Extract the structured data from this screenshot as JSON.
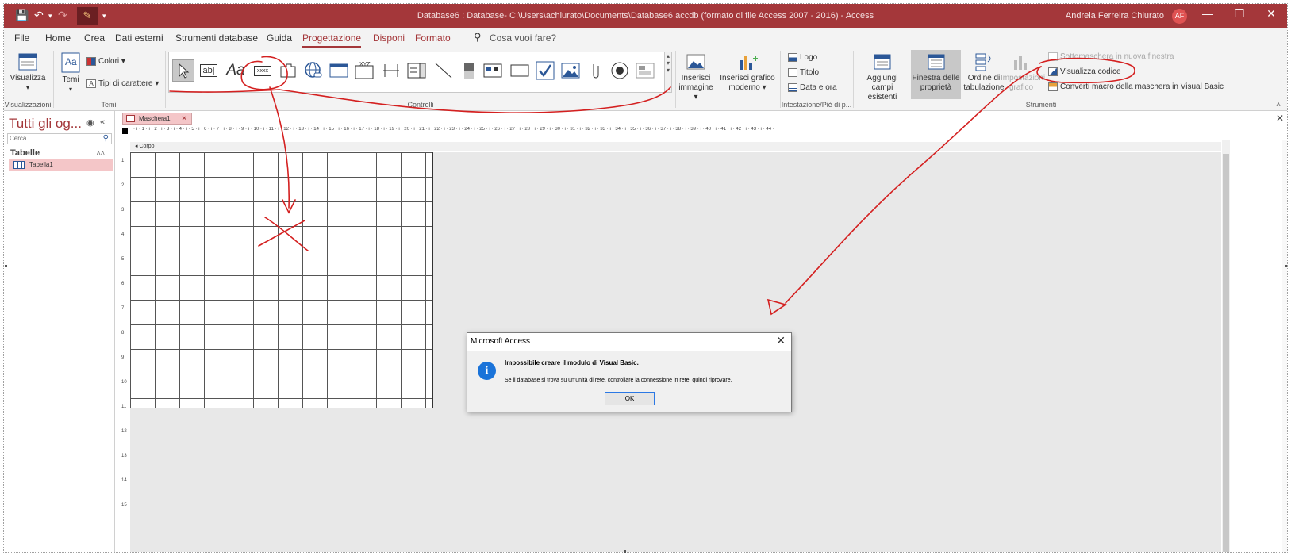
{
  "titlebar": {
    "title": "Database6 : Database- C:\\Users\\achiurato\\Documents\\Database6.accdb (formato di file Access 2007 - 2016)  -  Access",
    "user_name": "Andreia Ferreira Chiurato",
    "user_initials": "AF",
    "save_icon": "save-icon",
    "undo_icon": "undo-icon",
    "redo_icon": "redo-icon"
  },
  "tabs": {
    "file": "File",
    "home": "Home",
    "create": "Crea",
    "external": "Dati esterni",
    "dbtools": "Strumenti database",
    "help": "Guida",
    "design": "Progettazione",
    "arrange": "Disponi",
    "format": "Formato",
    "tell_me": "Cosa vuoi fare?"
  },
  "ribbon": {
    "views": {
      "button": "Visualizza",
      "group": "Visualizzazioni"
    },
    "themes": {
      "button": "Temi",
      "colors": "Colori",
      "fonts": "Tipi di carattere",
      "group": "Temi"
    },
    "controls": {
      "group": "Controlli",
      "items": [
        "select-icon",
        "textbox-icon",
        "label-icon",
        "button-icon",
        "tab-control-icon",
        "hyperlink-icon",
        "web-browser-icon",
        "navigation-control-icon",
        "option-group-icon",
        "page-break-icon",
        "combo-box-icon",
        "line-icon",
        "toggle-button-icon",
        "list-box-icon",
        "rectangle-icon",
        "checkbox-icon",
        "image-icon",
        "attachment-icon",
        "option-button-icon",
        "subform-icon"
      ]
    },
    "insert_image": "Inserisci immagine",
    "insert_chart": "Inserisci grafico moderno",
    "header_footer": {
      "logo": "Logo",
      "title": "Titolo",
      "datetime": "Data e ora",
      "group": "Intestazione/Piè di p..."
    },
    "tools": {
      "group": "Strumenti",
      "add_fields": "Aggiungi campi esistenti",
      "property_sheet": "Finestra delle proprietà",
      "tab_order": "Ordine di tabulazione",
      "chart_settings": "Impostazioni grafico",
      "subform_new_window": "Sottomaschera in nuova finestra",
      "view_code": "Visualizza codice",
      "convert_macros": "Converti macro della maschera in Visual Basic"
    }
  },
  "nav": {
    "header": "Tutti gli og...",
    "search_placeholder": "Cerca...",
    "section": "Tabelle",
    "items": [
      {
        "label": "Tabella1"
      }
    ]
  },
  "document": {
    "tab_label": "Maschera1",
    "section_label": "Corpo",
    "ruler_h_text": "· ı · 1 · ı · 2 · ı · 3 · ı · 4 · ı · 5 · ı · 6 · ı · 7 · ı · 8 · ı · 9 · ı · 10 · ı · 11 · ı · 12 · ı · 13 · ı · 14 · ı · 15 · ı · 16 · ı · 17 · ı · 18 · ı · 19 · ı · 20 · ı · 21 · ı · 22 · ı · 23 · ı · 24 · ı · 25 · ı · 26 · ı · 27 · ı · 28 · ı · 29 · ı · 30 · ı · 31 · ı · 32 · ı · 33 · ı · 34 · ı · 35 · ı · 36 · ı · 37 · ı · 38 · ı · 39 · ı · 40 · ı · 41 · ı · 42 · ı · 43 · ı · 44 ·",
    "ruler_v": [
      "1",
      "2",
      "3",
      "4",
      "5",
      "6",
      "7",
      "8",
      "9",
      "10",
      "11",
      "12",
      "13",
      "14",
      "15"
    ]
  },
  "dialog": {
    "title": "Microsoft Access",
    "message": "Impossibile creare il modulo di Visual Basic.",
    "detail": "Se il database si trova su un'unità di rete, controllare la connessione in rete, quindi riprovare.",
    "ok": "OK"
  },
  "colors": {
    "accent": "#a4373a",
    "annotation": "#d42020",
    "info": "#1a73d9"
  }
}
